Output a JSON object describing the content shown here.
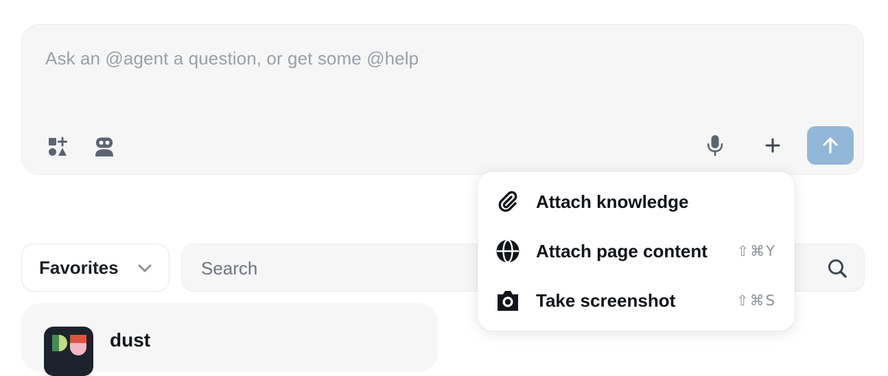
{
  "composer": {
    "placeholder": "Ask an @agent a question, or get some @help",
    "send_button_color": "#93b7d9",
    "icons": [
      "tools-icon",
      "robot-icon",
      "microphone-icon",
      "plus-icon",
      "arrow-up-icon"
    ]
  },
  "attach_menu": {
    "items": [
      {
        "label": "Attach knowledge",
        "icon": "paperclip-icon",
        "shortcut": ""
      },
      {
        "label": "Attach page content",
        "icon": "globe-icon",
        "shortcut": "⇧⌘Y"
      },
      {
        "label": "Take screenshot",
        "icon": "camera-icon",
        "shortcut": "⇧⌘S"
      }
    ]
  },
  "filter": {
    "dropdown_value": "Favorites",
    "search_placeholder": "Search"
  },
  "agents": [
    {
      "name": "dust",
      "icon": "dust-logo"
    }
  ]
}
